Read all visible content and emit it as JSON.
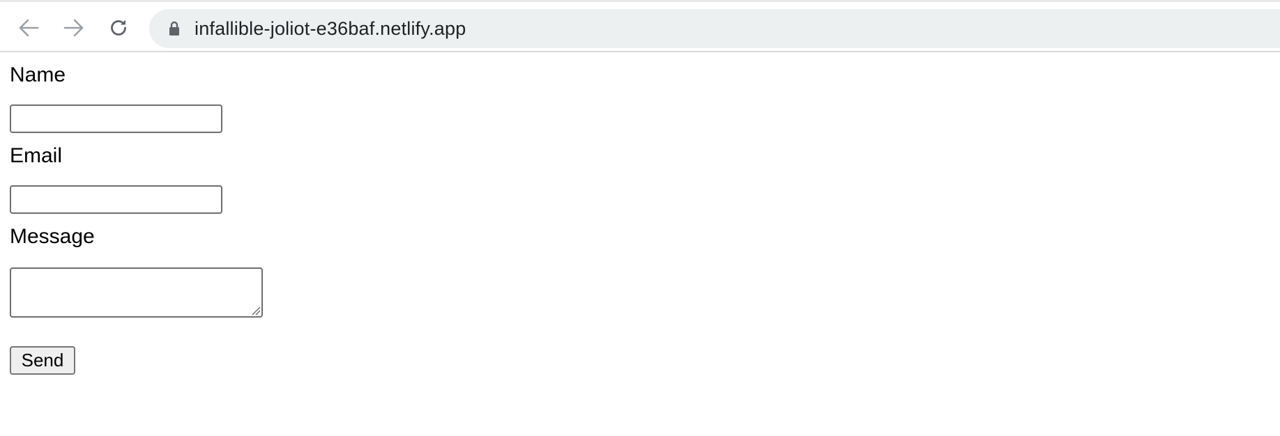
{
  "browser": {
    "url": "infallible-joliot-e36baf.netlify.app",
    "icons": {
      "back": "arrow-left-icon",
      "forward": "arrow-right-icon",
      "reload": "reload-icon",
      "lock": "lock-icon"
    }
  },
  "form": {
    "name_label": "Name",
    "name_value": "",
    "email_label": "Email",
    "email_value": "",
    "message_label": "Message",
    "message_value": "",
    "send_label": "Send"
  }
}
